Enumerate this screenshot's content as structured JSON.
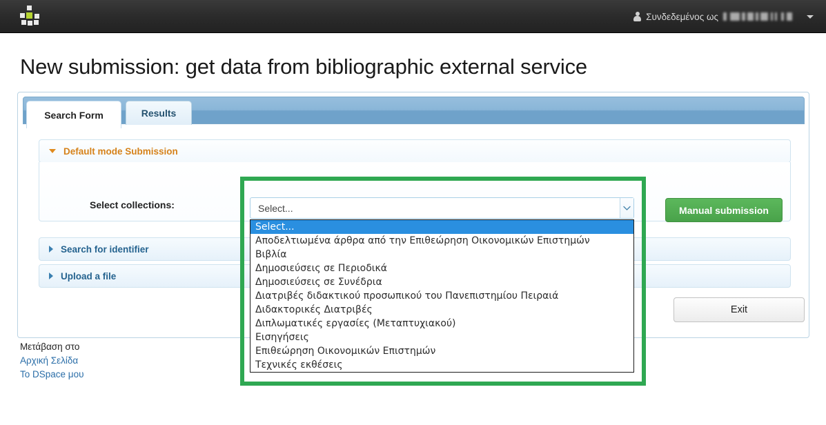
{
  "navbar": {
    "logo_icon": "dspace-logo-icon",
    "person_icon": "person-icon",
    "logged_in_label": "Συνδεδεμένος ως",
    "username_redacted": "",
    "caret_icon": "caret-down-icon"
  },
  "page": {
    "title": "New submission: get data from bibliographic external service"
  },
  "tabs": [
    {
      "id": "search-form",
      "label": "Search Form",
      "active": true
    },
    {
      "id": "results",
      "label": "Results",
      "active": false
    }
  ],
  "accordion": [
    {
      "id": "default-mode-submission",
      "label": "Default mode Submission",
      "expanded": true,
      "icon": "triangle-down-icon",
      "color": "#d6821a"
    },
    {
      "id": "search-for-identifier",
      "label": "Search for identifier",
      "expanded": false,
      "icon": "triangle-right-icon",
      "color": "#25638f"
    },
    {
      "id": "upload-a-file",
      "label": "Upload a file",
      "expanded": false,
      "icon": "triangle-right-icon",
      "color": "#25638f"
    }
  ],
  "form": {
    "select_collections_label": "Select collections:",
    "select_value": "Select...",
    "select_arrow_icon": "chevron-down-icon",
    "manual_submission_label": "Manual submission",
    "exit_label": "Exit"
  },
  "dropdown": {
    "open": true,
    "selected_index": 0,
    "options": [
      "Select...",
      "Αποδελτιωμένα άρθρα από την Επιθεώρηση Οικονομικών Επιστημών",
      "Βιβλία",
      "Δημοσιεύσεις σε Περιοδικά",
      "Δημοσιεύσεις σε Συνέδρια",
      "Διατριβές διδακτικού προσωπικού του Πανεπιστημίου Πειραιά",
      "Διδακτορικές Διατριβές",
      "Διπλωματικές εργασίες (Μεταπτυχιακού)",
      "Εισηγήσεις",
      "Επιθεώρηση Οικονομικών Επιστημών",
      "Τεχνικές εκθέσεις"
    ]
  },
  "highlight": {
    "color": "#2fa852"
  },
  "footer": {
    "heading": "Μετάβαση στο",
    "links": [
      "Αρχική Σελίδα",
      "Το DSpace μου"
    ]
  },
  "colors": {
    "navbar_bg": "#2b2b2b",
    "logo_green": "#b6d430",
    "tab_strip": "#8ab6d8",
    "accent_orange": "#d6821a",
    "accent_blue": "#25638f",
    "green_button": "#4fae4f",
    "highlight_green": "#2fa852",
    "dropdown_selected": "#2a8fe0",
    "link_blue": "#2b6ea8"
  }
}
